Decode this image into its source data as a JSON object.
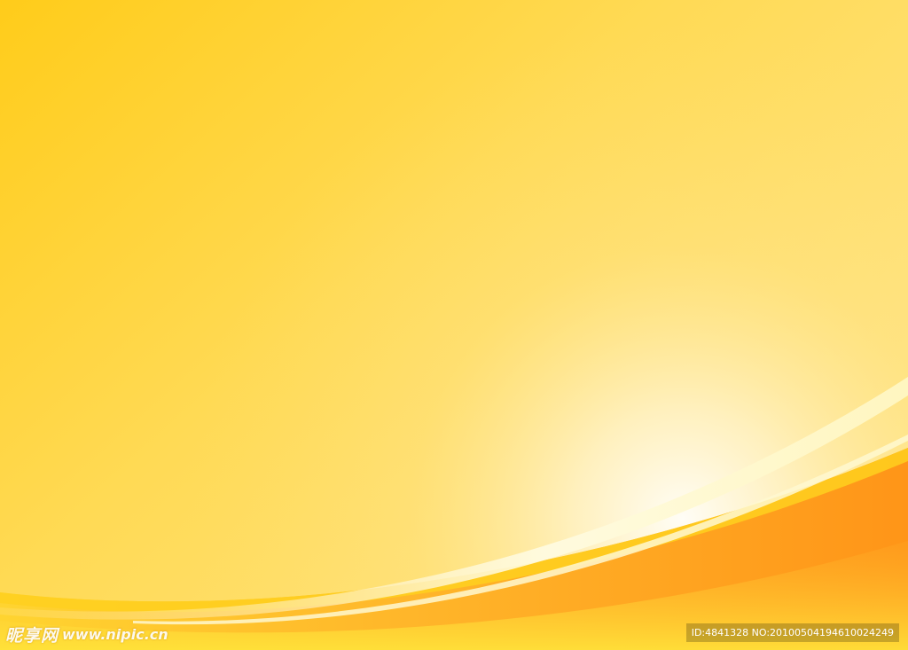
{
  "background": {
    "colors": {
      "top_left": "#ffcc1a",
      "top_right": "#ffe06a",
      "glow_center": "#fffaf0",
      "mid": "#ffe79a",
      "wave_orange": "#ff9a20",
      "wave_deep_orange": "#ff8a10",
      "wave_light": "#fff6c0",
      "band_yellow": "#ffd01e"
    }
  },
  "watermark": {
    "brand": "昵享网",
    "url": "www.nipic.cn",
    "id_text": "ID:4841328 NO:20100504194610024249"
  }
}
